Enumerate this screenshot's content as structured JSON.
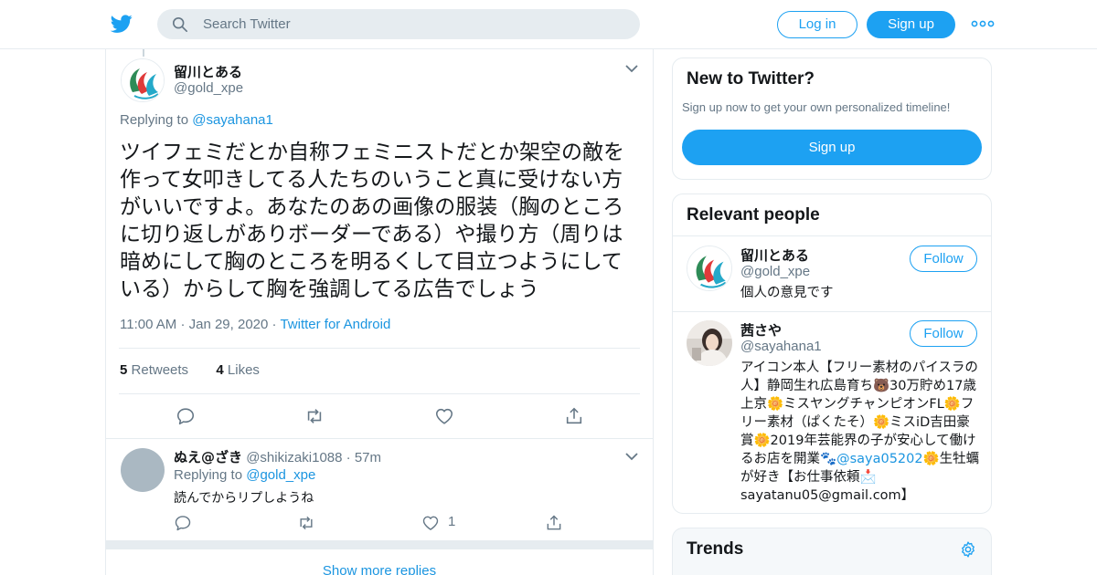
{
  "header": {
    "search_placeholder": "Search Twitter",
    "login_label": "Log in",
    "signup_label": "Sign up"
  },
  "tweet": {
    "author_name": "留川とある",
    "author_handle": "@gold_xpe",
    "replying_prefix": "Replying to ",
    "replying_to": "@sayahana1",
    "text": "ツイフェミだとか自称フェミニストだとか架空の敵を作って女叩きしてる人たちのいうこと真に受けない方がいいですよ。あなたのあの画像の服装（胸のところに切り返しがありボーダーである）や撮り方（周りは暗めにして胸のところを明るくして目立つようにしている）からして胸を強調してる広告でしょう",
    "time": "11:00 AM",
    "date": "Jan 29, 2020",
    "source": "Twitter for Android",
    "retweets_count": "5",
    "retweets_label": "Retweets",
    "likes_count": "4",
    "likes_label": "Likes"
  },
  "reply": {
    "author_name": "ぬえ@ざき",
    "author_handle": "@shikizaki1088",
    "age": "57m",
    "replying_prefix": "Replying to ",
    "replying_to": "@gold_xpe",
    "text": "読んでからリプしようね",
    "like_count": "1"
  },
  "show_more": "Show more replies",
  "sidebar": {
    "new_title": "New to Twitter?",
    "new_sub": "Sign up now to get your own personalized timeline!",
    "signup_label": "Sign up",
    "relevant_title": "Relevant people",
    "people": [
      {
        "name": "留川とある",
        "handle": "@gold_xpe",
        "bio": "個人の意見です",
        "follow_label": "Follow"
      },
      {
        "name": "茜さや",
        "handle": "@sayahana1",
        "bio_before_link": "アイコン本人【フリー素材のパイスラの人】静岡生れ広島育ち🐻30万貯め17歳上京🌼ミスヤングチャンピオンFL🌼フリー素材（ぱくたそ）🌼ミスiD吉田豪賞🌼2019年芸能界の子が安心して働けるお店を開業🐾",
        "bio_link": "@saya05202",
        "bio_after_link": "🌼生牡蠣が好き【お仕事依頼📩sayatanu05@gmail.com】",
        "follow_label": "Follow"
      }
    ],
    "trends_title": "Trends"
  },
  "colors": {
    "brand": "#1da1f2",
    "link": "#1b95e0",
    "secondary_text": "#657786",
    "border": "#e6ecf0"
  },
  "icons": [
    "twitter-bird-icon",
    "search-icon",
    "more-dots-icon",
    "chevron-down-icon",
    "reply-icon",
    "retweet-icon",
    "like-icon",
    "share-icon",
    "gear-icon"
  ]
}
